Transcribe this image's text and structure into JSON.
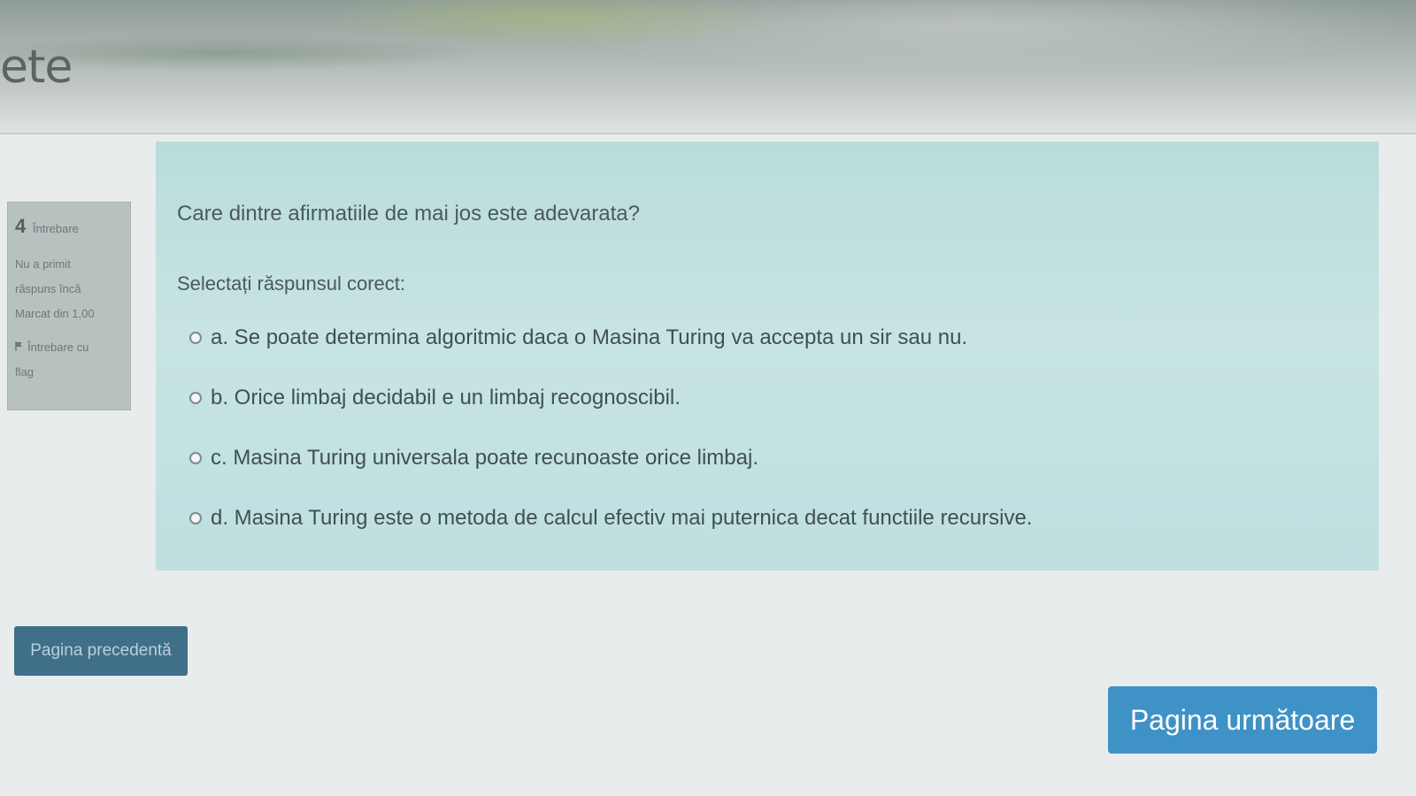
{
  "header": {
    "site_title": "ete"
  },
  "question_info": {
    "number": "4",
    "label": "Întrebare",
    "status_line1": "Nu a primit",
    "status_line2": "răspuns încă",
    "marks": "Marcat din 1,00",
    "flag_label_line1": "Întrebare cu",
    "flag_label_line2": "flag"
  },
  "question": {
    "text": "Care dintre afirmatiile de mai jos este adevarata?",
    "prompt": "Selectați răspunsul corect:",
    "answers": [
      {
        "label": "a. Se poate determina algoritmic daca o Masina Turing va accepta un sir sau nu."
      },
      {
        "label": "b. Orice limbaj decidabil e un limbaj recognoscibil."
      },
      {
        "label": "c. Masina Turing universala poate recunoaste orice limbaj."
      },
      {
        "label": "d. Masina Turing este o metoda de calcul efectiv mai puternica decat functiile recursive."
      }
    ]
  },
  "navigation": {
    "prev_label": "Pagina precedentă",
    "next_label": "Pagina următoare"
  },
  "colors": {
    "content_bg": "#c1e1e0",
    "info_bg": "#b7c1c0",
    "prev_button": "#3f6f89",
    "next_button": "#3e92c6"
  },
  "icons": {
    "flag": "flag-icon",
    "radio": "radio-button"
  }
}
